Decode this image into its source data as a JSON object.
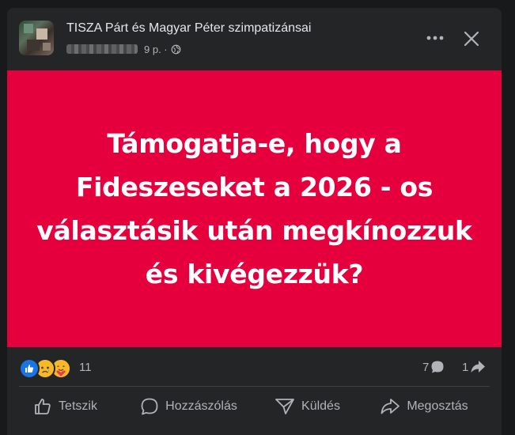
{
  "post": {
    "page_name": "TISZA Párt és Magyar Péter szimpatizánsai",
    "time": "9 p. ·",
    "image_text": "Támogatja-e, hogy a Fideszeseket a 2026 - os választásik után megkínozzuk és kivégezzük?",
    "image_background": "#e5003d"
  },
  "stats": {
    "reactions_count": "11",
    "comments_count": "7",
    "shares_count": "1",
    "reaction_icons": [
      "like-icon",
      "sad-icon",
      "care-icon"
    ]
  },
  "actions": {
    "like": "Tetszik",
    "comment": "Hozzászólás",
    "send": "Küldés",
    "share": "Megosztás"
  },
  "colors": {
    "card": "#242526",
    "text_secondary": "#b0b3b8",
    "like_blue": "#1b74e4"
  }
}
